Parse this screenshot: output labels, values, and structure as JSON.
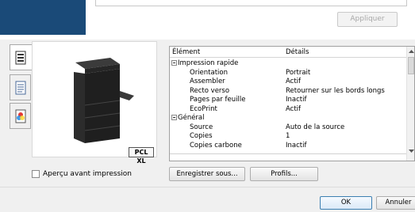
{
  "header": {
    "apply_label": "Appliquer"
  },
  "side_tabs": [
    {
      "icon": "printer-settings-icon"
    },
    {
      "icon": "document-layout-icon"
    },
    {
      "icon": "color-icon"
    }
  ],
  "preview": {
    "badge": "PCL XL"
  },
  "grid": {
    "col_element": "Élément",
    "col_details": "Détails",
    "rows": [
      {
        "type": "section",
        "key": "Impression rapide",
        "value": ""
      },
      {
        "type": "item",
        "key": "Orientation",
        "value": "Portrait"
      },
      {
        "type": "item",
        "key": "Assembler",
        "value": "Actif"
      },
      {
        "type": "item",
        "key": "Recto verso",
        "value": "Retourner sur les bords longs"
      },
      {
        "type": "item",
        "key": "Pages par feuille",
        "value": "Inactif"
      },
      {
        "type": "item",
        "key": "EcoPrint",
        "value": "Actif"
      },
      {
        "type": "section",
        "key": "Général",
        "value": ""
      },
      {
        "type": "item",
        "key": "Source",
        "value": "Auto de la source"
      },
      {
        "type": "item",
        "key": "Copies",
        "value": "1"
      },
      {
        "type": "item",
        "key": "Copies carbone",
        "value": "Inactif"
      }
    ]
  },
  "footer": {
    "preview_label": "Aperçu avant impression",
    "save_label": "Enregistrer sous...",
    "profiles_label": "Profils...",
    "ok_label": "OK",
    "cancel_label": "Annuler"
  }
}
